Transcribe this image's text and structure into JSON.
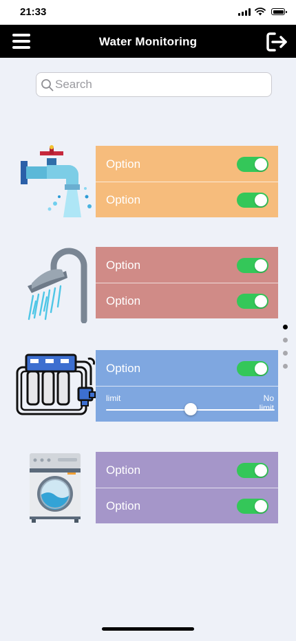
{
  "status_bar": {
    "time": "21:33"
  },
  "header": {
    "title": "Water Monitoring",
    "menu_icon": "hamburger-menu-icon",
    "logout_icon": "logout-icon"
  },
  "search": {
    "placeholder": "Search",
    "value": ""
  },
  "colors": {
    "header_bg": "#000000",
    "page_bg": "#eef1f8",
    "toggle_on": "#34c759"
  },
  "devices": [
    {
      "icon": "faucet-icon",
      "color": "#f6bc7c",
      "options": [
        {
          "label": "Option",
          "on": true
        },
        {
          "label": "Option",
          "on": true
        }
      ]
    },
    {
      "icon": "shower-icon",
      "color": "#d08b87",
      "options": [
        {
          "label": "Option",
          "on": true
        },
        {
          "label": "Option",
          "on": true
        }
      ]
    },
    {
      "icon": "water-filter-icon",
      "color": "#7fa7e0",
      "options": [
        {
          "label": "Option",
          "on": true
        }
      ],
      "slider": {
        "min_label": "limit",
        "max_label": "No limit",
        "value_fraction": 0.5
      }
    },
    {
      "icon": "washing-machine-icon",
      "color": "#a596c9",
      "options": [
        {
          "label": "Option",
          "on": true
        },
        {
          "label": "Option",
          "on": true
        }
      ]
    }
  ],
  "pagination": {
    "total": 4,
    "active_index": 0
  }
}
